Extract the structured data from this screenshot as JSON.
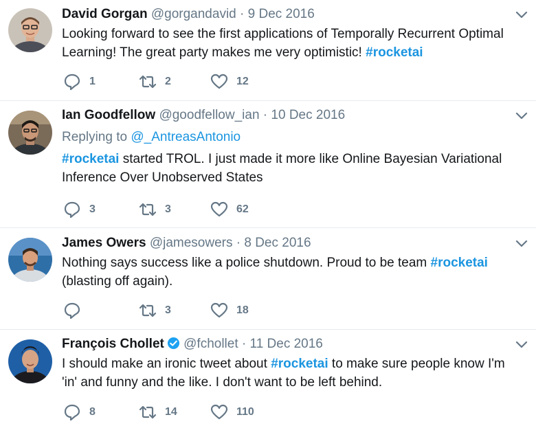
{
  "tweets": [
    {
      "name": "David Gorgan",
      "handle": "@gorgandavid",
      "separator": "·",
      "date": "9 Dec 2016",
      "verified": false,
      "reply_prefix": "",
      "reply_to": "",
      "text_before": "Looking forward to see the first applications of Temporally Recurrent Optimal Learning! The great party makes me very optimistic! ",
      "hashtag": "#rocketai",
      "text_after": "",
      "replies": "1",
      "retweets": "2",
      "likes": "12"
    },
    {
      "name": "Ian Goodfellow",
      "handle": "@goodfellow_ian",
      "separator": "·",
      "date": "10 Dec 2016",
      "verified": false,
      "reply_prefix": "Replying to ",
      "reply_to": "@_AntreasAntonio",
      "text_before": "",
      "hashtag": "#rocketai",
      "text_after": " started TROL. I just made it more like Online Bayesian Variational Inference Over Unobserved States",
      "replies": "3",
      "retweets": "3",
      "likes": "62"
    },
    {
      "name": "James Owers",
      "handle": "@jamesowers",
      "separator": "·",
      "date": "8 Dec 2016",
      "verified": false,
      "reply_prefix": "",
      "reply_to": "",
      "text_before": "Nothing says success like a police shutdown. Proud to be team ",
      "hashtag": "#rocketai",
      "text_after": " (blasting off again).",
      "replies": "",
      "retweets": "3",
      "likes": "18"
    },
    {
      "name": "François Chollet",
      "handle": "@fchollet",
      "separator": "·",
      "date": "11 Dec 2016",
      "verified": true,
      "reply_prefix": "",
      "reply_to": "",
      "text_before": "I should make an ironic tweet about ",
      "hashtag": "#rocketai",
      "text_after": " to make sure people know I'm 'in' and funny and the like. I don't want to be left behind.",
      "replies": "8",
      "retweets": "14",
      "likes": "110"
    }
  ],
  "icons": {
    "reply": "reply-icon",
    "retweet": "retweet-icon",
    "like": "heart-icon",
    "more": "chevron-down-icon",
    "verified": "verified-badge-icon"
  },
  "colors": {
    "link": "#1b95e0",
    "muted": "#657786",
    "text": "#14171a",
    "divider": "#e6ecf0"
  }
}
